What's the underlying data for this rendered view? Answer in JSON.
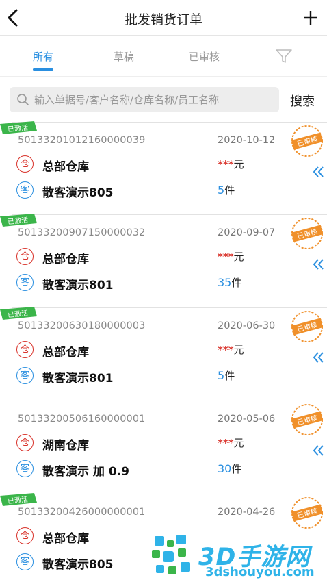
{
  "header": {
    "title": "批发销货订单"
  },
  "tabs": [
    {
      "label": "所有",
      "active": true
    },
    {
      "label": "草稿",
      "active": false
    },
    {
      "label": "已审核",
      "active": false
    }
  ],
  "search": {
    "placeholder": "输入单据号/客户名称/仓库名称/员工名称",
    "button_label": "搜索"
  },
  "orders": [
    {
      "activated_label": "已激活",
      "code": "50133201012160000039",
      "date": "2020-10-12",
      "stamp": "已审核",
      "warehouse": "总部仓库",
      "customer": "散客演示805",
      "amount_mask": "***",
      "amount_unit": "元",
      "qty": "5",
      "qty_unit": "件"
    },
    {
      "activated_label": "已激活",
      "code": "50133200907150000032",
      "date": "2020-09-07",
      "stamp": "已审核",
      "warehouse": "总部仓库",
      "customer": "散客演示801",
      "amount_mask": "***",
      "amount_unit": "元",
      "qty": "35",
      "qty_unit": "件"
    },
    {
      "activated_label": "已激活",
      "code": "50133200630180000003",
      "date": "2020-06-30",
      "stamp": "已审核",
      "warehouse": "总部仓库",
      "customer": "散客演示801",
      "amount_mask": "***",
      "amount_unit": "元",
      "qty": "5",
      "qty_unit": "件"
    },
    {
      "activated_label": "",
      "code": "50133200506160000001",
      "date": "2020-05-06",
      "stamp": "已审核",
      "warehouse": "湖南仓库",
      "customer": "散客演示 加 0.9",
      "amount_mask": "***",
      "amount_unit": "元",
      "qty": "30",
      "qty_unit": "件"
    },
    {
      "activated_label": "已激活",
      "code": "50133200426000000001",
      "date": "2020-04-26",
      "stamp": "已审核",
      "warehouse": "总部仓库",
      "customer": "散客演示805",
      "amount_mask": "",
      "amount_unit": "",
      "qty": "",
      "qty_unit": ""
    }
  ],
  "icons": {
    "warehouse": "仓",
    "customer": "客"
  },
  "watermark": {
    "brand": "3D手游网",
    "url": "3dshouyou.com"
  },
  "colors": {
    "accent": "#2a8fe0",
    "red": "#d9332b",
    "stamp": "#f0902a",
    "activated": "#3bb54a",
    "watermark": "#2fb3e8"
  }
}
